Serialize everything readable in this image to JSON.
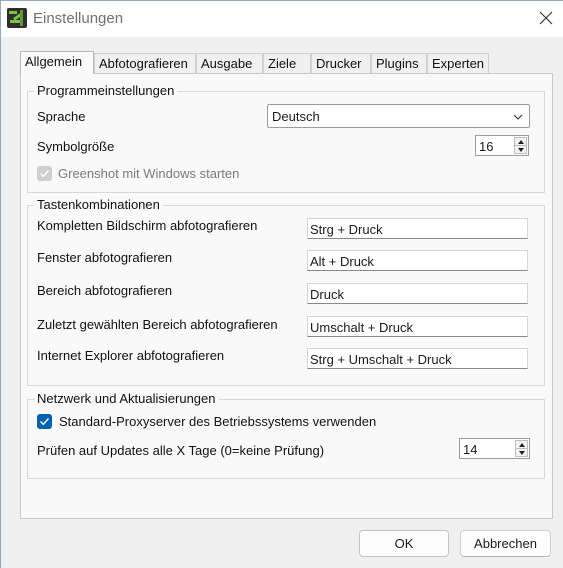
{
  "window": {
    "title": "Einstellungen"
  },
  "tabs": [
    {
      "label": "Allgemein",
      "active": true
    },
    {
      "label": "Abfotografieren"
    },
    {
      "label": "Ausgabe"
    },
    {
      "label": "Ziele"
    },
    {
      "label": "Drucker"
    },
    {
      "label": "Plugins"
    },
    {
      "label": "Experten"
    }
  ],
  "program": {
    "title": "Programmeinstellungen",
    "language_label": "Sprache",
    "language_value": "Deutsch",
    "icon_size_label": "Symbolgröße",
    "icon_size_value": "16",
    "autostart_label": "Greenshot mit Windows starten",
    "autostart_checked": true,
    "autostart_disabled": true
  },
  "hotkeys": {
    "title": "Tastenkombinationen",
    "items": [
      {
        "label": "Kompletten Bildschirm abfotografieren",
        "value": "Strg + Druck"
      },
      {
        "label": "Fenster abfotografieren",
        "value": "Alt + Druck"
      },
      {
        "label": "Bereich abfotografieren",
        "value": "Druck"
      },
      {
        "label": "Zuletzt gewählten Bereich abfotografieren",
        "value": "Umschalt + Druck"
      },
      {
        "label": "Internet Explorer abfotografieren",
        "value": "Strg + Umschalt + Druck"
      }
    ]
  },
  "network": {
    "title": "Netzwerk und Aktualisierungen",
    "proxy_label": "Standard-Proxyserver des Betriebssystems verwenden",
    "proxy_checked": true,
    "updates_label": "Prüfen auf Updates alle X Tage (0=keine Prüfung)",
    "updates_value": "14"
  },
  "footer": {
    "ok_label": "OK",
    "cancel_label": "Abbrechen"
  },
  "colors": {
    "accent": "#0063b1",
    "icon_green": "#7cc241"
  }
}
